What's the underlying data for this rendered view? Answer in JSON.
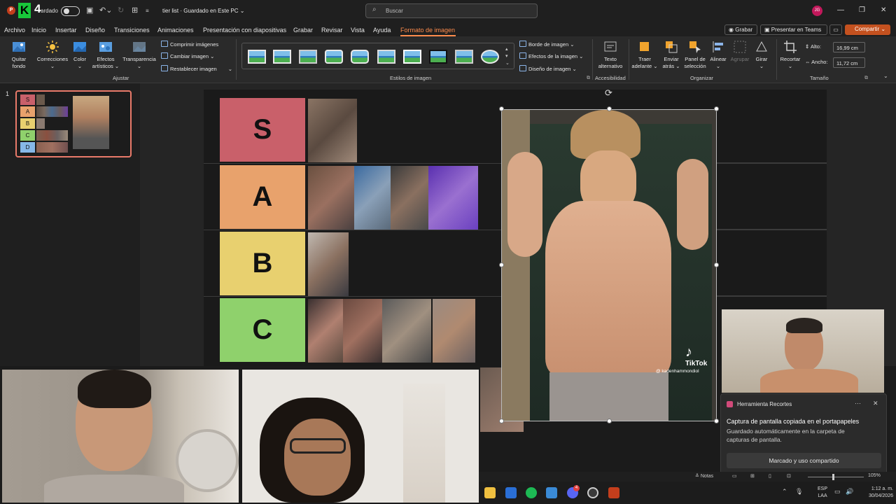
{
  "titlebar": {
    "logo_letter": "P",
    "overlay_letter": "K",
    "overlay_number": "4",
    "autosave_label": "ardado",
    "filename": "tier list · Guardado en Este PC ⌄",
    "search_placeholder": "Buscar",
    "avatar_initials": "JG",
    "win_min": "—",
    "win_max": "❐",
    "win_close": "✕"
  },
  "menu": {
    "items": [
      "Archivo",
      "Inicio",
      "Insertar",
      "Diseño",
      "Transiciones",
      "Animaciones",
      "Presentación con diapositivas",
      "Grabar",
      "Revisar",
      "Vista",
      "Ayuda",
      "Formato de imagen"
    ],
    "record_button": "Grabar",
    "teams_button": "Presentar en Teams",
    "share_button": "Compartir ⌄"
  },
  "ribbon": {
    "quitar_fondo": [
      "Quitar",
      "fondo"
    ],
    "correcciones": "Correcciones",
    "color": "Color",
    "efectos": [
      "Efectos",
      "artísticos ⌄"
    ],
    "transparencia": "Transparencia",
    "comprimir": "Comprimir imágenes",
    "cambiar": "Cambiar imagen ⌄",
    "restablecer": "Restablecer imagen",
    "group_ajustar": "Ajustar",
    "group_estilos": "Estilos de imagen",
    "borde": "Borde de imagen ⌄",
    "efectos_imagen": "Efectos de la imagen ⌄",
    "diseno_imagen": "Diseño de imagen ⌄",
    "texto_alt": [
      "Texto",
      "alternativo"
    ],
    "group_accesibilidad": "Accesibilidad",
    "traer": [
      "Traer",
      "adelante ⌄"
    ],
    "enviar": [
      "Enviar",
      "atrás ⌄"
    ],
    "panel": [
      "Panel de",
      "selección"
    ],
    "alinear": "Alinear ⌄",
    "agrupar": "Agrupar",
    "girar": "Girar",
    "group_organizar": "Organizar",
    "recortar": "Recortar",
    "alto_label": "Alto:",
    "alto_value": "16,99 cm",
    "ancho_label": "Ancho:",
    "ancho_value": "11,72 cm",
    "group_tamano": "Tamaño"
  },
  "slides": {
    "number": "1",
    "thumb_tiers": [
      "S",
      "A",
      "B",
      "C",
      "D"
    ]
  },
  "tiers": [
    {
      "label": "S",
      "color": "#c9606a"
    },
    {
      "label": "A",
      "color": "#e8a26c"
    },
    {
      "label": "B",
      "color": "#e8d06f"
    },
    {
      "label": "C",
      "color": "#8fd16c"
    }
  ],
  "selected_image": {
    "watermark_brand": "TikTok",
    "watermark_handle": "@ kadenhammondiol"
  },
  "notification": {
    "app": "Herramienta Recortes",
    "title": "Captura de pantalla copiada en el portapapeles",
    "body": "Guardado automáticamente en la carpeta de capturas de pantalla.",
    "action": "Marcado y uso compartido"
  },
  "statusbar": {
    "notes": "Notas",
    "zoom": "105%"
  },
  "taskbar": {
    "lang": "ESP",
    "region": "LAA",
    "time": "1:12 a. m.",
    "date": "30/04/2026",
    "badge": "4"
  }
}
